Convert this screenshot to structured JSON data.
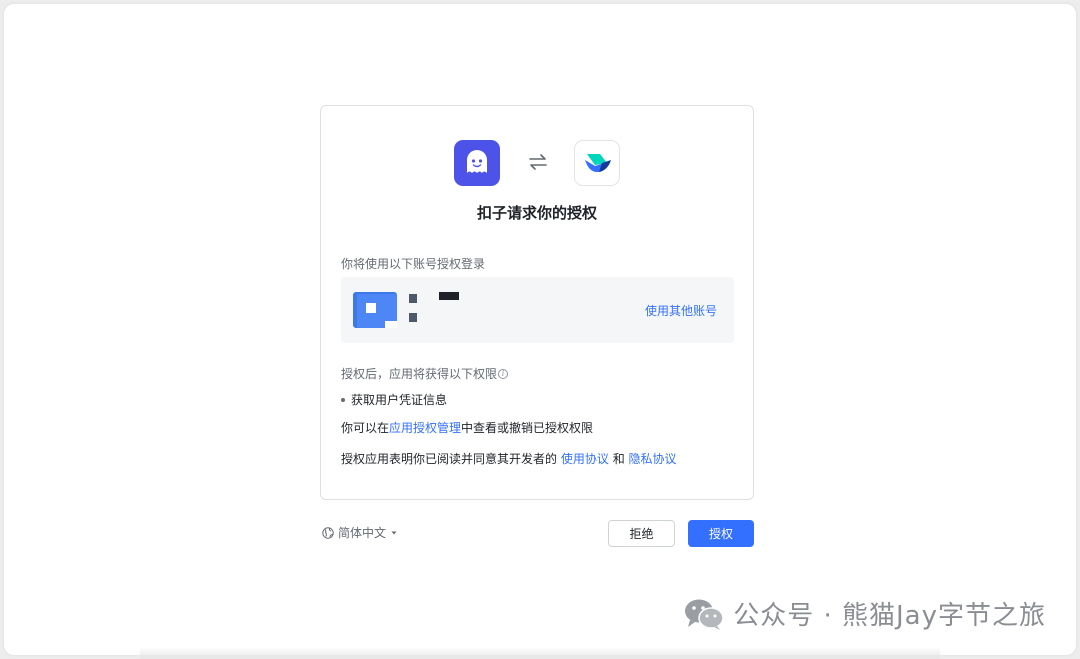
{
  "dialog": {
    "title": "扣子请求你的授权",
    "exchange_icon": "exchange-arrows-icon",
    "apps": [
      {
        "name": "coze-app-icon",
        "color": "#4d53e8"
      },
      {
        "name": "feishu-app-icon",
        "color": "#ffffff"
      }
    ],
    "account_label": "你将使用以下账号授权登录",
    "switch_account": "使用其他账号",
    "permissions_label": "授权后，应用将获得以下权限",
    "permission_items": [
      "获取用户凭证信息"
    ],
    "manage_text_prefix": "你可以在",
    "manage_link": "应用授权管理",
    "manage_text_suffix": "中查看或撤销已授权权限",
    "agreement_prefix": "授权应用表明你已阅读并同意其开发者的",
    "terms_link": "使用协议",
    "agreement_and": "和",
    "privacy_link": "隐私协议"
  },
  "footer": {
    "language": "简体中文",
    "reject_label": "拒绝",
    "authorize_label": "授权"
  },
  "watermark": {
    "text": "公众号 · 熊猫Jay字节之旅"
  },
  "colors": {
    "primary": "#3370ff",
    "coze_brand": "#4d53e8",
    "text": "#1f2329",
    "secondary_text": "#646a73"
  }
}
